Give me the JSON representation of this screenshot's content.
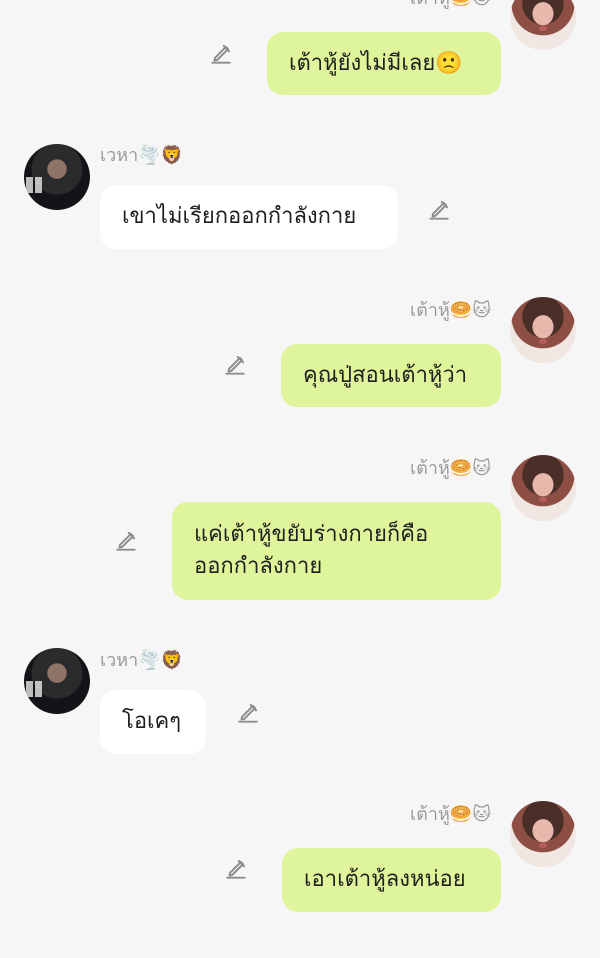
{
  "chat": {
    "messages": [
      {
        "sender": "เต้าหู้🥯🐱",
        "text": "เต้าหู้ยังไม่มีเลย🙁",
        "side": "outgoing"
      },
      {
        "sender": "เวหา🌪️🦁",
        "text": "เขาไม่เรียกออกกำลังกาย",
        "side": "incoming"
      },
      {
        "sender": "เต้าหู้🥯🐱",
        "text": "คุณปู่สอนเต้าหู้ว่า",
        "side": "outgoing"
      },
      {
        "sender": "เต้าหู้🥯🐱",
        "text": "แค่เต้าหู้ขยับร่างกายก็คือ\nออกกำลังกาย",
        "side": "outgoing"
      },
      {
        "sender": "เวหา🌪️🦁",
        "text": "โอเคๆ",
        "side": "incoming"
      },
      {
        "sender": "เต้าหู้🥯🐱",
        "text": "เอาเต้าหู้ลงหน่อย",
        "side": "outgoing"
      }
    ]
  },
  "colors": {
    "background": "#f6f6f6",
    "outgoing_bubble": "#dff59b",
    "incoming_bubble": "#ffffff",
    "meta_text": "#9a9a9a"
  },
  "icons": {
    "edit": "pencil-icon",
    "avatar_left": "avatar",
    "avatar_right": "avatar"
  }
}
